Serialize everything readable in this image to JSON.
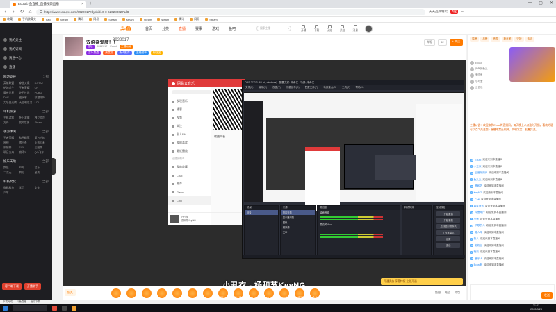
{
  "browser": {
    "tab_title": "Ecust斗鱼直播_直播视频直播",
    "url": "https://www.douyu.com/8922017?dyshid=0-0-6202806271d8",
    "right_badge": "天天品牌特卖",
    "right_label": "0元",
    "window_controls": [
      "—",
      "▢",
      "✕"
    ],
    "bookmarks": [
      "收藏",
      "手机收藏夹",
      "hao",
      "Steam",
      "腾讯",
      "网易",
      "Steam",
      "steam",
      "Steam",
      "steam",
      "腾讯",
      "网易",
      "Steam"
    ]
  },
  "sidebar": {
    "top_items": [
      "我的关注",
      "我的订阅",
      "消息中心",
      "直播"
    ],
    "sections": [
      {
        "title": "网游竞技",
        "more": "全部",
        "items": [
          "英雄联盟",
          "穿越火线",
          "DOTA2",
          "绝地求生",
          "王者荣耀",
          "CF",
          "魔兽世界",
          "炉石传说",
          "PUBG",
          "DNF",
          "逆水寒",
          "守望先锋",
          "刀塔自走棋",
          "天涯明月刀",
          "LOL"
        ]
      },
      {
        "title": "单机热游",
        "more": "全部",
        "items": [
          "主机游戏",
          "怀旧游戏",
          "独立游戏",
          "方舟",
          "我的世界",
          "Steam"
        ]
      },
      {
        "title": "手游休闲",
        "more": "全部",
        "items": [
          "王者荣耀",
          "和平精英",
          "第五人格",
          "原神",
          "狼人杀",
          "火影忍者",
          "阴阳师",
          "FIFA",
          "三国杀",
          "明日方舟",
          "崩坏3",
          "QQ飞车"
        ]
      },
      {
        "title": "娱乐天地",
        "more": "全部",
        "items": [
          "颜值",
          "户外",
          "音乐",
          "二次元",
          "舞蹈",
          "星秀"
        ]
      },
      {
        "title": "科技文化",
        "more": "全部",
        "items": [
          "数码科技",
          "学习",
          "文化",
          "汽车"
        ]
      }
    ],
    "bottom_buttons": [
      "客户端下载",
      "开播助手"
    ]
  },
  "site": {
    "logo": "斗鱼",
    "nav": [
      "首页",
      "分类",
      "直播",
      "赛事",
      "游戏",
      "鱼吧"
    ],
    "active_nav": "直播",
    "search_placeholder": "搜索主播",
    "header_icons": [
      "开播",
      "下载",
      "历史",
      "关注",
      "消息"
    ]
  },
  "streamer": {
    "name": "双倍亲爱度！！",
    "room_id": "8922017",
    "category": "音乐",
    "meta": [
      "8922017",
      "Ecust",
      "主播认证"
    ],
    "badges": [
      {
        "label": "音乐频道",
        "color": "#8a2be2"
      },
      {
        "label": "热度榜",
        "color": "#ff5d23"
      },
      {
        "label": "新人推荐",
        "color": "#5b6cff"
      },
      {
        "label": "主播勋章",
        "color": "#2b8df5"
      },
      {
        "label": "粉丝团",
        "color": "#ffb300"
      }
    ],
    "follow": "+ 关注",
    "report": "举报",
    "fans": "52"
  },
  "video": {
    "netease_title": "网易云音乐",
    "netease_items": [
      "发现音乐",
      "播客",
      "视频",
      "关注",
      "私人FM",
      "我的喜欢",
      "最近播放",
      "我的收藏",
      "Chat",
      "推荐",
      "Game",
      "Chill"
    ],
    "netease_section": "创建的歌单",
    "netease_label": "歌曲列表",
    "netease_footer_song": "小丑衣",
    "netease_footer_artist": "杨和苏KeyNG",
    "obs_title": "OBS 27.2.3 (64-bit, windows) - 配置文件: 未命名 - 场景: 未命名",
    "obs_menu": [
      "文件(F)",
      "编辑(E)",
      "视图(V)",
      "停靠部件(D)",
      "配置文件(P)",
      "场景集合(S)",
      "工具(T)",
      "帮助(H)"
    ],
    "obs_docks": [
      "场景",
      "来源",
      "混音器",
      "转场特效",
      "控制按钮"
    ],
    "obs_scenes": [
      "场景"
    ],
    "obs_sources": [
      "窗口采集",
      "显示器采集",
      "图像",
      "媒体源",
      "文本"
    ],
    "obs_mixer": [
      "桌面音频",
      "麦克风/Aux"
    ],
    "obs_controls": [
      "开始直播",
      "开始录制",
      "启动虚拟摄像机",
      "工作室模式",
      "设置",
      "退出"
    ],
    "subtitle": "小丑衣 - 杨和苏KeyNG",
    "credits": "作词：杨和苏KeyNG 作曲：杨和苏"
  },
  "giftbar": {
    "left": "鱼丸",
    "banner": "开通贵族 享受特权 立即开通",
    "right": [
      "鱼翅",
      "充值",
      "背包"
    ]
  },
  "right_panel": {
    "tabs": [
      "周榜",
      "月榜",
      "贵宾",
      "粉丝团",
      "守护",
      "活动"
    ],
    "rank_names": [
      "Ecust",
      "帅气的鱼丸",
      "爱吃鱼",
      "小可爱",
      "云音乐"
    ],
    "notice": "主播公告：欢迎来到Ecust的直播间，每天晚上八点准时开播，喜欢的话可以点个关注哦~ 直播中禁止刷屏，文明发言，友善交流。",
    "chat": [
      {
        "lv": "12",
        "name": "Ecust",
        "msg": "欢迎来到本直播间"
      },
      {
        "lv": "8",
        "name": "小丑衣",
        "msg": "欢迎来到本直播间"
      },
      {
        "lv": "15",
        "name": "云音乐用户",
        "msg": "欢迎来到本直播间"
      },
      {
        "lv": "6",
        "name": "鱼丸丸",
        "msg": "欢迎来到本直播间"
      },
      {
        "lv": "22",
        "name": "杨和苏",
        "msg": "欢迎来到本直播间"
      },
      {
        "lv": "9",
        "name": "KeyNG",
        "msg": "欢迎来到本直播间"
      },
      {
        "lv": "11",
        "name": "Chill",
        "msg": "欢迎来到本直播间"
      },
      {
        "lv": "5",
        "name": "喜欢音乐",
        "msg": "欢迎来到本直播间"
      },
      {
        "lv": "14",
        "name": "斗鱼用户",
        "msg": "欢迎来到本直播间"
      },
      {
        "lv": "7",
        "name": "小鱼",
        "msg": "欢迎来到本直播间"
      },
      {
        "lv": "18",
        "name": "听歌的人",
        "msg": "欢迎来到本直播间"
      },
      {
        "lv": "10",
        "name": "路人甲",
        "msg": "欢迎来到本直播间"
      },
      {
        "lv": "3",
        "name": "新人",
        "msg": "欢迎来到本直播间"
      },
      {
        "lv": "20",
        "name": "老粉丝",
        "msg": "欢迎来到本直播间"
      },
      {
        "lv": "4",
        "name": "晚安",
        "msg": "欢迎来到本直播间"
      },
      {
        "lv": "16",
        "name": "音乐人",
        "msg": "欢迎来到本直播间"
      },
      {
        "lv": "2",
        "name": "Ecust粉",
        "msg": "欢迎来到本直播间"
      }
    ],
    "send": "发送"
  },
  "statusbar": [
    "下载完成",
    "斗鱼直播",
    "官方下载"
  ],
  "taskbar": {
    "time": "21:02",
    "date": "2022/3/28"
  }
}
